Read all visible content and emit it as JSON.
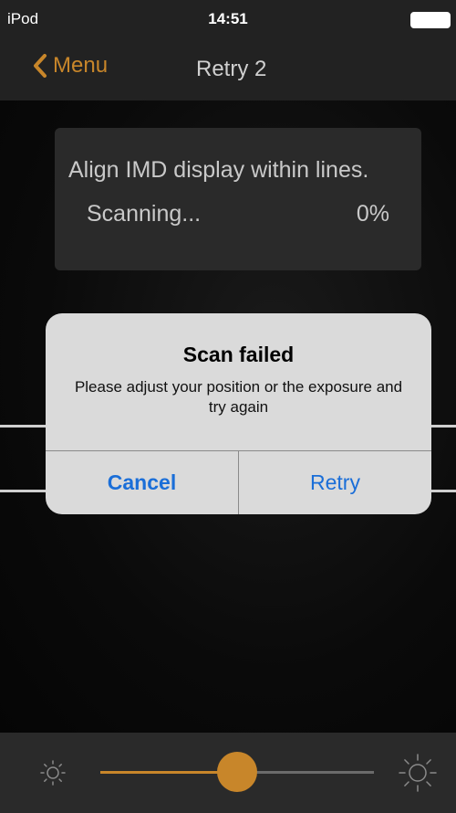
{
  "status_bar": {
    "carrier": "iPod",
    "time": "14:51"
  },
  "nav": {
    "back_label": "Menu",
    "title": "Retry 2"
  },
  "scan_panel": {
    "instruction": "Align IMD display within lines.",
    "status": "Scanning...",
    "progress": "0%"
  },
  "alert": {
    "title": "Scan failed",
    "message": "Please adjust your position or the exposure and try again",
    "cancel_label": "Cancel",
    "retry_label": "Retry"
  },
  "exposure": {
    "value": 0.5,
    "icons": [
      "sun-dim-icon",
      "sun-bright-icon"
    ]
  },
  "colors": {
    "accent": "#c8862a",
    "alert_button": "#1a6ed8",
    "bar": "#222222"
  }
}
